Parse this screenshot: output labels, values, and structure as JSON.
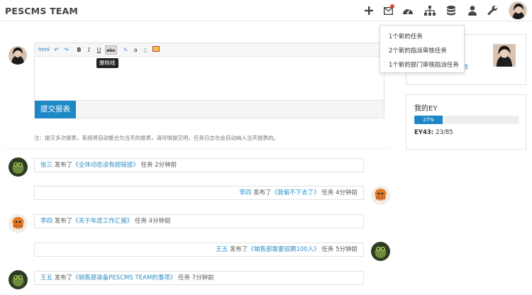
{
  "brand": "PESCMS TEAM",
  "nav": {
    "icons": [
      "plus-icon",
      "mail-icon",
      "dashboard-icon",
      "sitemap-icon",
      "database-icon",
      "user-icon",
      "wrench-icon"
    ],
    "notification_color": "#e2432d"
  },
  "notifications": {
    "items": [
      {
        "label": "1个新的任务"
      },
      {
        "label": "2个新的指派审核任务"
      },
      {
        "label": "1个新的部门审核指派任务"
      }
    ]
  },
  "editor": {
    "toolbar": [
      "html",
      "undo",
      "redo",
      "B",
      "I",
      "U",
      "abc",
      "link",
      "a",
      "doc",
      "img"
    ],
    "tooltip": "删除线",
    "submit_label": "提交报表"
  },
  "note": "注：提交多次报表，系统将自动整合为当天的报表，请尽情提交吧。任务日志也会自动纳入当天报表的。",
  "feed": [
    {
      "user": "张三",
      "action": "发布了",
      "task": "《全体动态没有超链接》",
      "suffix": "任务 2分钟前",
      "side": "left"
    },
    {
      "user": "李四",
      "action": "发布了",
      "task": "《我偏不下去了》",
      "suffix": "任务 4分钟前",
      "side": "right"
    },
    {
      "user": "李四",
      "action": "发布了",
      "task": "《关于年度工作汇报》",
      "suffix": "任务 4分钟前",
      "side": "left"
    },
    {
      "user": "王五",
      "action": "发布了",
      "task": "《销售部需要招聘100人》",
      "suffix": "任务 5分钟前",
      "side": "right"
    },
    {
      "user": "王五",
      "action": "发布了",
      "task": "《销售部准备PESCMS TEAM的事项》",
      "suffix": "任务 7分钟前",
      "side": "left"
    }
  ],
  "profile": {
    "link_text": "修"
  },
  "ey": {
    "title": "我的EY",
    "percent": 27,
    "percent_label": "27%",
    "stat_label": "EY43:",
    "stat_value": "23/85"
  },
  "colors": {
    "accent": "#1e88c7",
    "link": "#2a8fc7"
  }
}
